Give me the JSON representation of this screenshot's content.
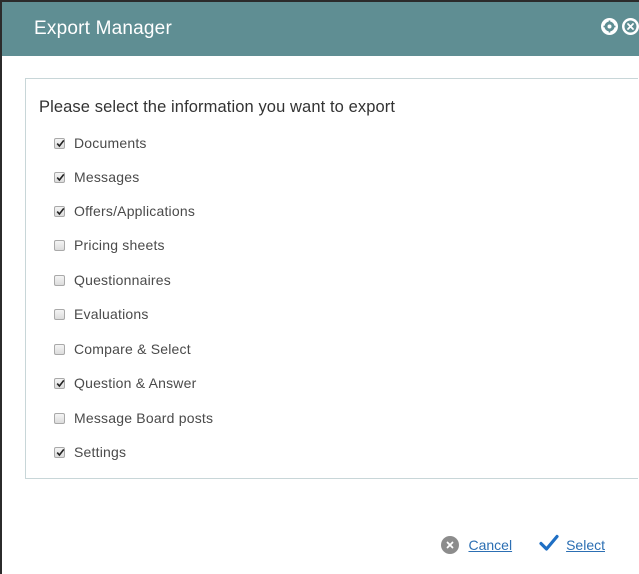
{
  "dialog": {
    "title": "Export Manager",
    "icons": [
      "settings-gear-icon",
      "close-icon"
    ]
  },
  "prompt": "Please select the information you want to export",
  "options": [
    {
      "label": "Documents",
      "checked": true
    },
    {
      "label": "Messages",
      "checked": true
    },
    {
      "label": "Offers/Applications",
      "checked": true
    },
    {
      "label": "Pricing sheets",
      "checked": false
    },
    {
      "label": "Questionnaires",
      "checked": false
    },
    {
      "label": "Evaluations",
      "checked": false
    },
    {
      "label": "Compare & Select",
      "checked": false
    },
    {
      "label": "Question & Answer",
      "checked": true
    },
    {
      "label": "Message Board posts",
      "checked": false
    },
    {
      "label": "Settings",
      "checked": true
    }
  ],
  "footer": {
    "cancel_label": "Cancel",
    "select_label": "Select"
  },
  "colors": {
    "titlebar": "#5f8e93",
    "link": "#2c6fb3",
    "check": "#1f6fc4"
  }
}
